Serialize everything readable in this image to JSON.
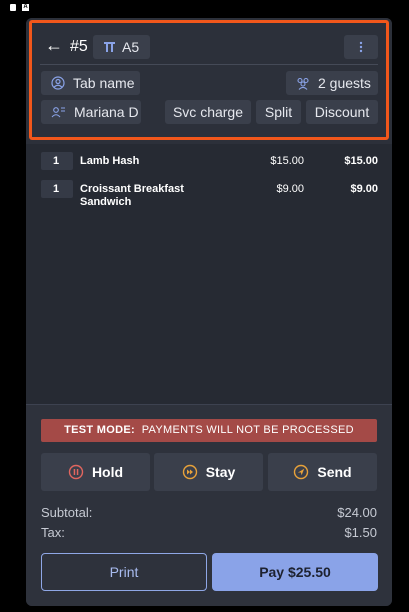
{
  "header": {
    "order_number": "#5",
    "table": "A5",
    "tab_name": "Tab name",
    "guests": "2 guests",
    "server": "Mariana D",
    "svc_charge": "Svc charge",
    "split": "Split",
    "discount": "Discount"
  },
  "items": [
    {
      "qty": "1",
      "name": "Lamb Hash",
      "price": "$15.00",
      "total": "$15.00"
    },
    {
      "qty": "1",
      "name": "Croissant Breakfast Sandwich",
      "price": "$9.00",
      "total": "$9.00"
    }
  ],
  "banner": {
    "label": "TEST MODE:",
    "text": "PAYMENTS WILL NOT BE PROCESSED"
  },
  "actions": {
    "hold": "Hold",
    "stay": "Stay",
    "send": "Send"
  },
  "summary": {
    "subtotal_label": "Subtotal:",
    "subtotal": "$24.00",
    "tax_label": "Tax:",
    "tax": "$1.50"
  },
  "buttons": {
    "print": "Print",
    "pay": "Pay $25.50"
  },
  "colors": {
    "highlight": "#f2571b",
    "accent": "#8aa3e8",
    "hold_icon": "#e2665f",
    "stay_icon": "#e8a23a",
    "send_icon": "#e8a23a",
    "banner": "#a44a47"
  },
  "icons": {
    "back": "arrow-left-icon",
    "table": "table-icon",
    "menu": "more-vertical-icon",
    "tab": "user-circle-icon",
    "guests": "group-icon",
    "server": "server-icon",
    "hold": "pause-circle-icon",
    "stay": "fast-forward-icon",
    "send": "send-icon"
  }
}
